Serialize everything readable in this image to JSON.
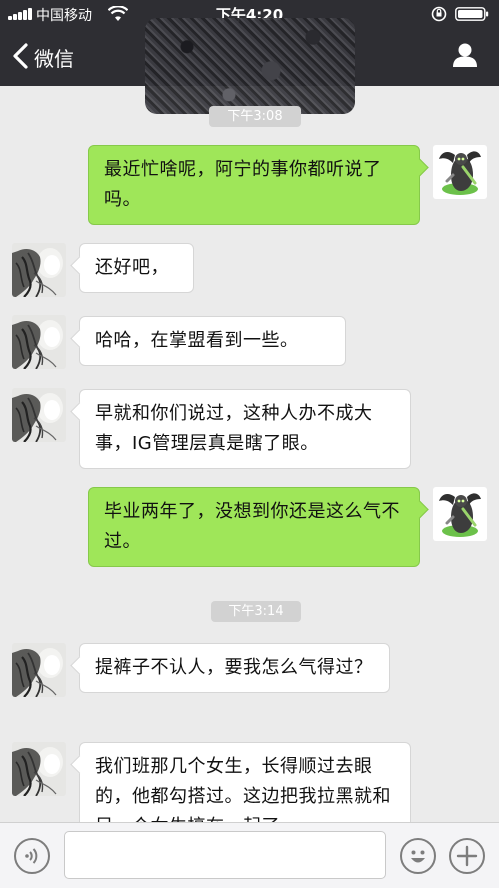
{
  "status_bar": {
    "carrier": "中国移动",
    "time": "下午4:20"
  },
  "nav": {
    "back_label": "微信",
    "back_icon": "chevron-left-icon",
    "profile_icon": "person-icon"
  },
  "chat": {
    "time_1": "下午3:08",
    "time_2": "下午3:14",
    "msg_1": "最近忙啥呢，阿宁的事你都听说了吗。",
    "msg_2": "还好吧，",
    "msg_3": "哈哈，在掌盟看到一些。",
    "msg_4": "早就和你们说过，这种人办不成大事，IG管理层真是瞎了眼。",
    "msg_5": "毕业两年了，没想到你还是这么气不过。",
    "msg_6": "提裤子不认人，要我怎么气得过？",
    "msg_7": "我们班那几个女生，长得顺过去眼的，他都勾搭过。这边把我拉黑就和另一个女生搞在一起了。"
  },
  "colors": {
    "header_bg": "#2e2e33",
    "chat_bg": "#ebebeb",
    "outgoing_bubble": "#9fe659",
    "incoming_bubble": "#ffffff",
    "time_badge": "#d2d2d2"
  },
  "input_bar": {
    "voice_icon": "voice-icon",
    "emoji_icon": "smiley-icon",
    "plus_icon": "plus-icon",
    "text_value": ""
  }
}
